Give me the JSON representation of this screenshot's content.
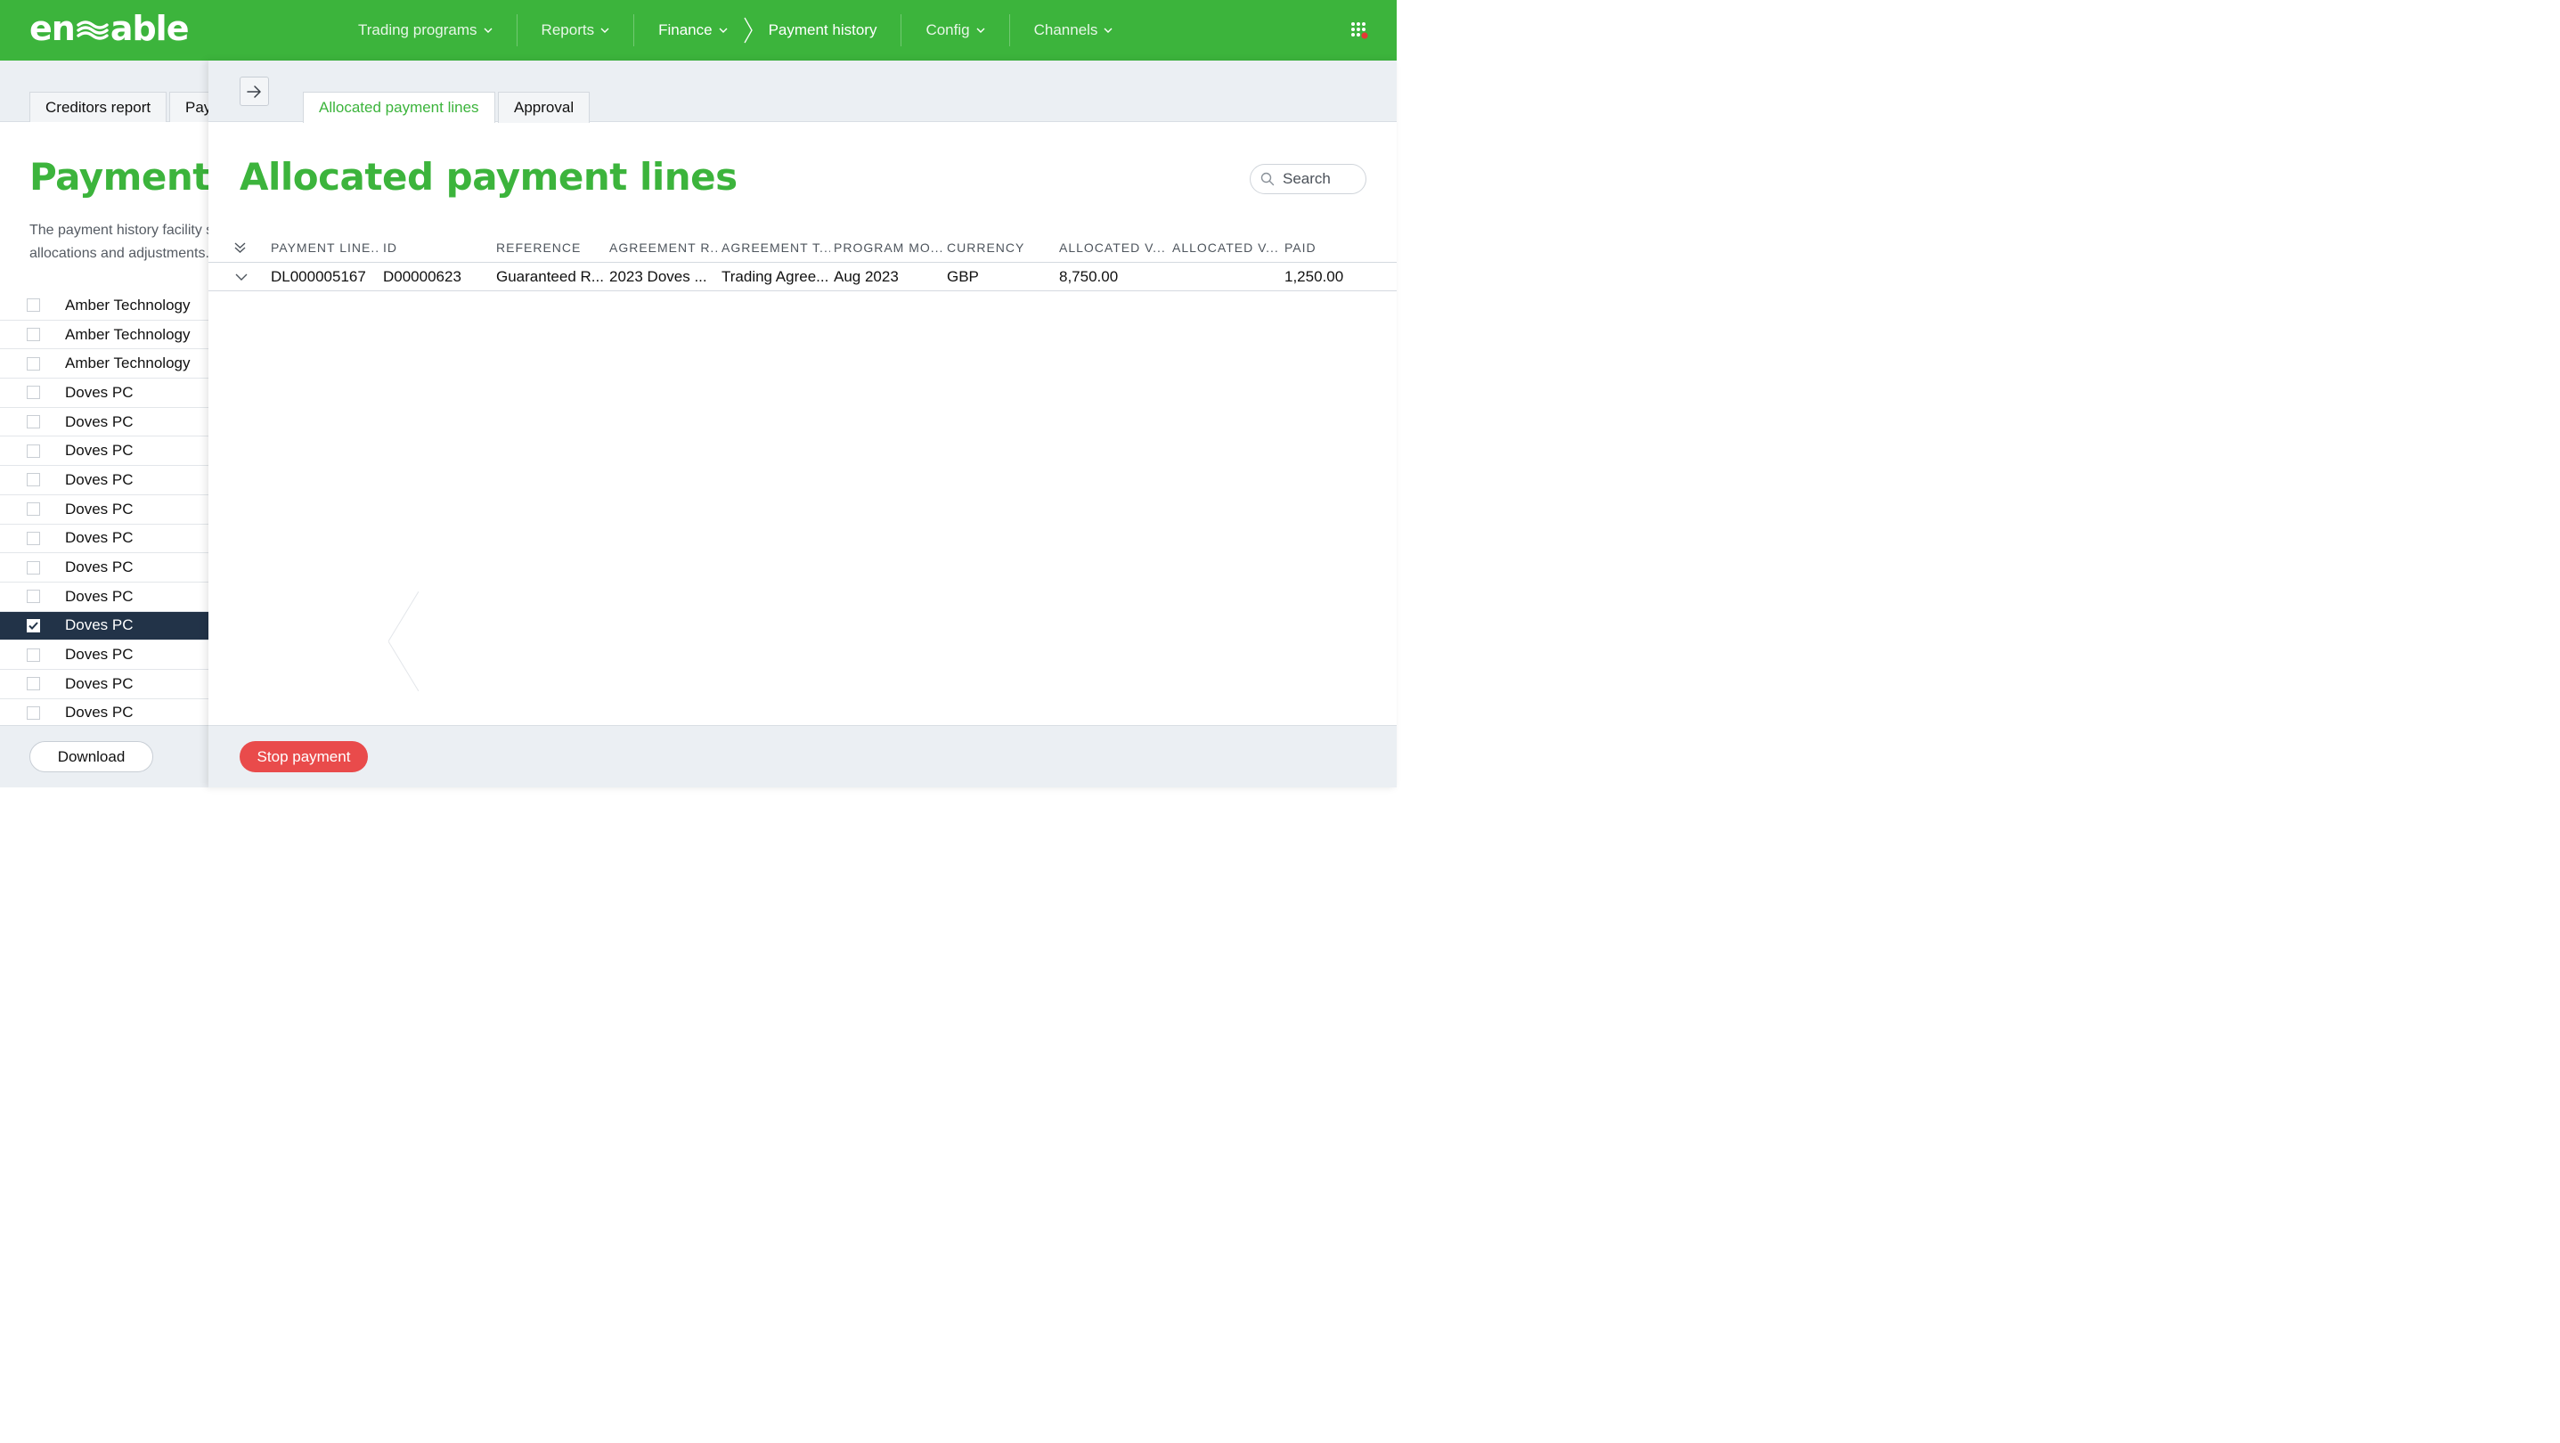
{
  "app": {
    "logo_text": "en≈able",
    "colors": {
      "brand_green": "#3cb43c",
      "nav_bg": "#3cb43c",
      "selected_row": "#223348",
      "danger": "#e94b4b",
      "notification_dot": "#e53935"
    }
  },
  "nav": {
    "items": [
      {
        "label": "Trading programs",
        "icon": "chevron-down-icon"
      },
      {
        "label": "Reports",
        "icon": "chevron-down-icon"
      },
      {
        "label": "Finance",
        "icon": "chevron-down-icon"
      },
      {
        "label": "Payment history"
      },
      {
        "label": "Config",
        "icon": "chevron-down-icon"
      },
      {
        "label": "Channels",
        "icon": "chevron-down-icon"
      }
    ],
    "apps_icon": "grid-apps-icon"
  },
  "left_panel": {
    "tabs": [
      {
        "label": "Creditors report"
      },
      {
        "label": "Payment history"
      }
    ],
    "title": "Payment history",
    "description_lines": [
      "The payment history facility shows the history of payments made, including",
      "allocations and adjustments."
    ],
    "list": [
      {
        "label": "Amber Technology",
        "checked": false
      },
      {
        "label": "Amber Technology",
        "checked": false
      },
      {
        "label": "Amber Technology",
        "checked": false
      },
      {
        "label": "Doves PC",
        "checked": false
      },
      {
        "label": "Doves PC",
        "checked": false
      },
      {
        "label": "Doves PC",
        "checked": false
      },
      {
        "label": "Doves PC",
        "checked": false
      },
      {
        "label": "Doves PC",
        "checked": false
      },
      {
        "label": "Doves PC",
        "checked": false
      },
      {
        "label": "Doves PC",
        "checked": false
      },
      {
        "label": "Doves PC",
        "checked": false
      },
      {
        "label": "Doves PC",
        "checked": true
      },
      {
        "label": "Doves PC",
        "checked": false
      },
      {
        "label": "Doves PC",
        "checked": false
      },
      {
        "label": "Doves PC",
        "checked": false
      }
    ],
    "download_label": "Download"
  },
  "drawer": {
    "tabs": [
      {
        "label": "Allocated payment lines",
        "active": true
      },
      {
        "label": "Approval",
        "active": false
      }
    ],
    "title": "Allocated payment lines",
    "search_placeholder": "Search",
    "columns": [
      "PAYMENT LINE...",
      "ID",
      "REFERENCE",
      "AGREEMENT R...",
      "AGREEMENT T...",
      "PROGRAM MO...",
      "CURRENCY",
      "ALLOCATED V...",
      "ALLOCATED V...",
      "PAID"
    ],
    "rows": [
      [
        "DL000005167",
        "D00000623",
        "Guaranteed R...",
        "2023 Doves ...",
        "Trading Agree...",
        "Aug 2023",
        "GBP",
        "8,750.00",
        "",
        "1,250.00"
      ]
    ],
    "stop_payment_label": "Stop payment"
  }
}
